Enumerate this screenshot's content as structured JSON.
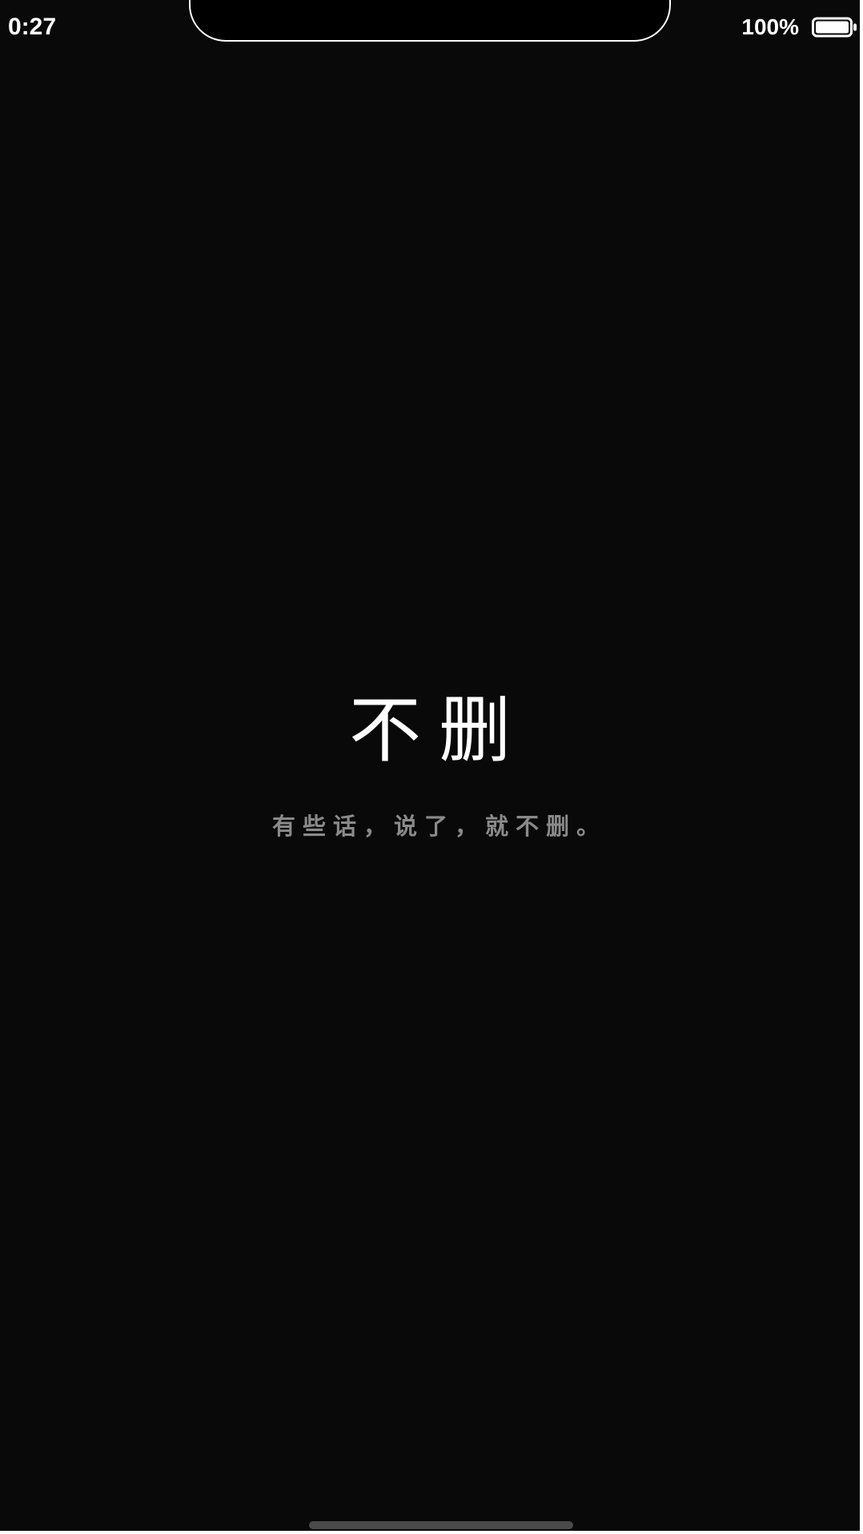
{
  "status_bar": {
    "time": "0:27",
    "battery_percent": "100%",
    "battery_icon": "battery-full-icon"
  },
  "content": {
    "title": "不删",
    "subtitle": "有些话，说了，就不删。"
  },
  "colors": {
    "background": "#090909",
    "title_text": "#ffffff",
    "subtitle_text": "#8a8a8a"
  }
}
